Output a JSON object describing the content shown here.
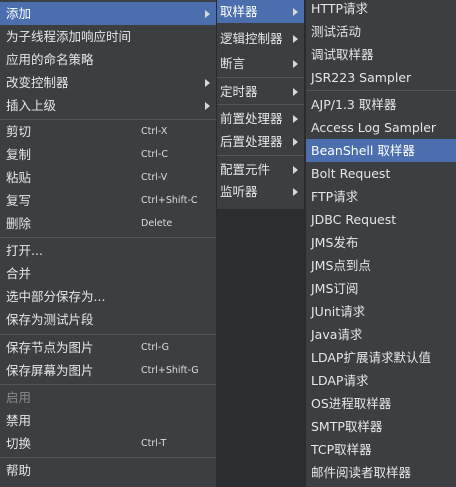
{
  "main_menu": {
    "items": [
      {
        "label": "添加",
        "shortcut": ""
      },
      {
        "label": "为子线程添加响应时间",
        "shortcut": ""
      },
      {
        "label": "应用的命名策略",
        "shortcut": ""
      },
      {
        "label": "改变控制器",
        "shortcut": ""
      },
      {
        "label": "插入上级",
        "shortcut": ""
      },
      {
        "label": "剪切",
        "shortcut": "Ctrl-X"
      },
      {
        "label": "复制",
        "shortcut": "Ctrl-C"
      },
      {
        "label": "粘贴",
        "shortcut": "Ctrl-V"
      },
      {
        "label": "复写",
        "shortcut": "Ctrl+Shift-C"
      },
      {
        "label": "删除",
        "shortcut": "Delete"
      },
      {
        "label": "打开...",
        "shortcut": ""
      },
      {
        "label": "合并",
        "shortcut": ""
      },
      {
        "label": "选中部分保存为...",
        "shortcut": ""
      },
      {
        "label": "保存为测试片段",
        "shortcut": ""
      },
      {
        "label": "保存节点为图片",
        "shortcut": "Ctrl-G"
      },
      {
        "label": "保存屏幕为图片",
        "shortcut": "Ctrl+Shift-G"
      },
      {
        "label": "启用",
        "shortcut": ""
      },
      {
        "label": "禁用",
        "shortcut": ""
      },
      {
        "label": "切换",
        "shortcut": "Ctrl-T"
      },
      {
        "label": "帮助",
        "shortcut": ""
      }
    ]
  },
  "add_submenu": {
    "items": [
      {
        "label": "取样器"
      },
      {
        "label": "逻辑控制器"
      },
      {
        "label": "断言"
      },
      {
        "label": "定时器"
      },
      {
        "label": "前置处理器"
      },
      {
        "label": "后置处理器"
      },
      {
        "label": "配置元件"
      },
      {
        "label": "监听器"
      }
    ]
  },
  "sampler_submenu": {
    "items": [
      {
        "label": "HTTP请求"
      },
      {
        "label": "测试活动"
      },
      {
        "label": "调试取样器"
      },
      {
        "label": "JSR223 Sampler"
      },
      {
        "label": "AJP/1.3 取样器"
      },
      {
        "label": "Access Log Sampler"
      },
      {
        "label": "BeanShell 取样器"
      },
      {
        "label": "Bolt Request"
      },
      {
        "label": "FTP请求"
      },
      {
        "label": "JDBC Request"
      },
      {
        "label": "JMS发布"
      },
      {
        "label": "JMS点到点"
      },
      {
        "label": "JMS订阅"
      },
      {
        "label": "JUnit请求"
      },
      {
        "label": "Java请求"
      },
      {
        "label": "LDAP扩展请求默认值"
      },
      {
        "label": "LDAP请求"
      },
      {
        "label": "OS进程取样器"
      },
      {
        "label": "SMTP取样器"
      },
      {
        "label": "TCP取样器"
      },
      {
        "label": "邮件阅读者取样器"
      }
    ]
  },
  "colors": {
    "menu_bg": "#3c3f41",
    "selection": "#4b6eaf",
    "text": "#e6e6e6",
    "disabled_text": "#8a8a8a"
  }
}
